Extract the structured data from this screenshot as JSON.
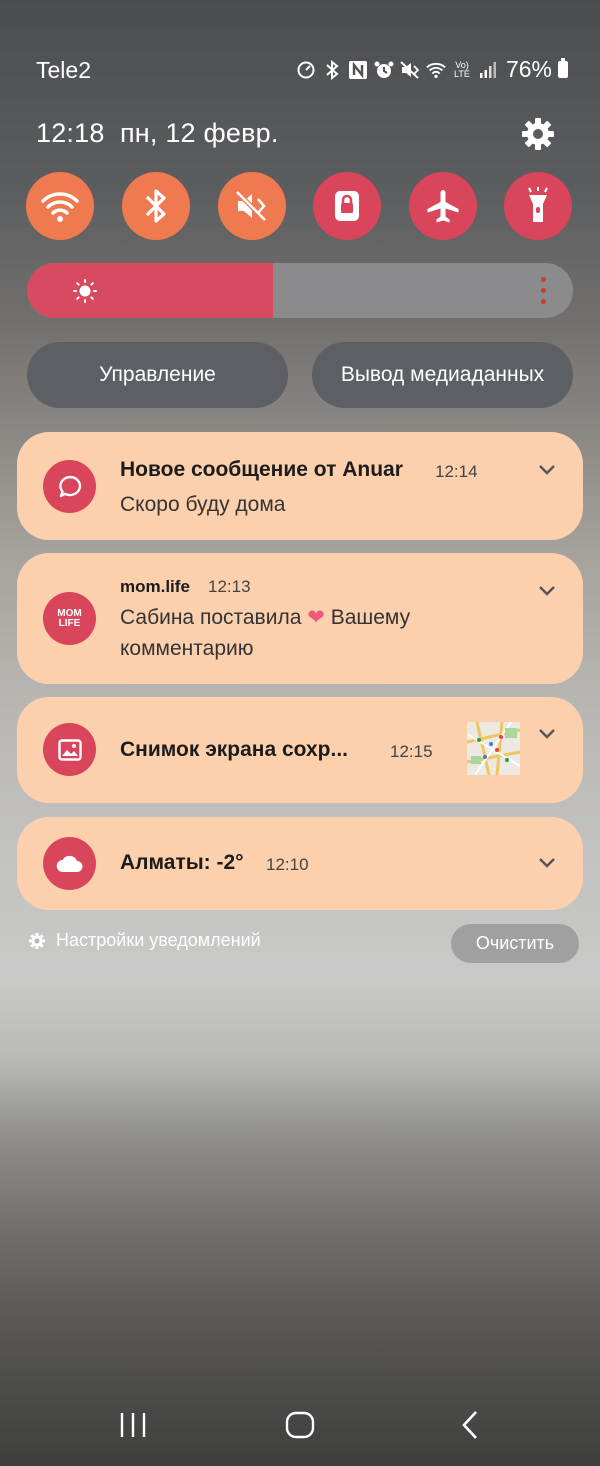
{
  "status_bar": {
    "carrier": "Tele2",
    "battery_percent": "76%",
    "volte_label": "Vo)\nLTE",
    "icons": [
      "speedometer-icon",
      "bluetooth-icon",
      "nfc-icon",
      "alarm-icon",
      "mute-icon",
      "wifi-icon",
      "volte-icon",
      "signal-icon",
      "battery-icon"
    ]
  },
  "header": {
    "time": "12:18",
    "date": "пн, 12 февр."
  },
  "quick_settings": [
    {
      "name": "wifi",
      "icon": "wifi-icon",
      "color": "#f07a50"
    },
    {
      "name": "bluetooth",
      "icon": "bluetooth-icon",
      "color": "#f07a50"
    },
    {
      "name": "sound",
      "icon": "mute-icon",
      "color": "#f07a50"
    },
    {
      "name": "screen-lock",
      "icon": "lock-icon",
      "color": "#d9455b"
    },
    {
      "name": "airplane",
      "icon": "airplane-icon",
      "color": "#d9455b"
    },
    {
      "name": "flashlight",
      "icon": "flashlight-icon",
      "color": "#d9455b"
    }
  ],
  "brightness": {
    "level": 0.45
  },
  "pills": {
    "control": "Управление",
    "media_output": "Вывод медиаданных"
  },
  "notifications": [
    {
      "title": "Новое сообщение от Anuar",
      "time": "12:14",
      "body": "Скоро буду дома",
      "icon": "message-bubble-icon"
    },
    {
      "app": "mom.life",
      "time": "12:13",
      "body_line1": "Сабина поставила",
      "heart": "❤️",
      "body_line1_end": "Вашему",
      "body_line2": "комментарию",
      "icon_text_top": "MOM",
      "icon_text_bottom": "LIFE"
    },
    {
      "title": "Снимок экрана сохр...",
      "time": "12:15",
      "icon": "image-icon"
    },
    {
      "title": "Алматы: -2°",
      "time": "12:10",
      "icon": "cloud-icon"
    }
  ],
  "footer": {
    "settings_label": "Настройки уведомлений",
    "clear_label": "Очистить"
  },
  "accent_colors": {
    "orange": "#f07a50",
    "red": "#d9455b",
    "card": "#fdd0ad"
  }
}
